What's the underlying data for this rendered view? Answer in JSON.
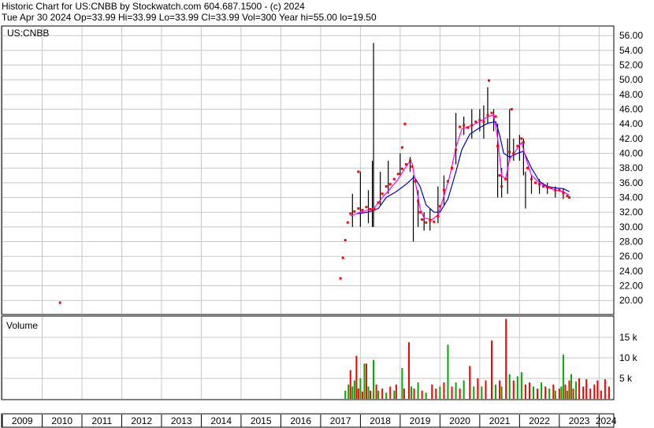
{
  "header": {
    "line1": "Historic Chart for US:CNBB by Stockwatch.com 604.687.1500 - (c) 2024",
    "line2": "Tue Apr 30 2024   Op=33.99   Hi=33.99   Lo=33.99   Cl=33.99   Vol=300   Year hi=55.00   lo=19.50"
  },
  "price_panel": {
    "symbol_label": "US:CNBB"
  },
  "volume_panel": {
    "title": "Volume"
  },
  "colors": {
    "price_bar": "#000000",
    "close_dot": "#ff0000",
    "ma_short": "#ff00ff",
    "ma_long": "#0000cc",
    "vol_up": "#00aa00",
    "vol_down": "#ff0000",
    "grid": "#c8c8c8"
  },
  "chart_data": [
    {
      "type": "line",
      "name": "price",
      "y_ticks": [
        "56.00",
        "54.00",
        "52.00",
        "50.00",
        "48.00",
        "46.00",
        "44.00",
        "42.00",
        "40.00",
        "38.00",
        "36.00",
        "34.00",
        "32.00",
        "30.00",
        "28.00",
        "26.00",
        "24.00",
        "22.00",
        "20.00"
      ],
      "ylim": [
        18.2,
        57.2
      ],
      "x_ticks": [
        "2009",
        "2010",
        "2011",
        "2012",
        "2013",
        "2014",
        "2015",
        "2016",
        "2017",
        "2018",
        "2019",
        "2020",
        "2021",
        "2022",
        "2023",
        "2024"
      ],
      "xlim": [
        2009.0,
        2024.35
      ],
      "grid": true,
      "closes": [
        [
          2010.45,
          19.7
        ],
        [
          2017.5,
          23.0
        ],
        [
          2017.56,
          25.8
        ],
        [
          2017.62,
          28.2
        ],
        [
          2017.68,
          30.6
        ],
        [
          2017.75,
          31.8
        ],
        [
          2017.85,
          32.1
        ],
        [
          2017.95,
          32.5
        ],
        [
          2018.05,
          32.3
        ],
        [
          2018.15,
          32.7
        ],
        [
          2018.25,
          32.4
        ],
        [
          2018.35,
          32.4
        ],
        [
          2018.45,
          33.3
        ],
        [
          2018.55,
          34.5
        ],
        [
          2018.65,
          35.5
        ],
        [
          2018.75,
          35.8
        ],
        [
          2018.85,
          36.5
        ],
        [
          2018.95,
          37.2
        ],
        [
          2019.05,
          37.9
        ],
        [
          2019.15,
          38.5
        ],
        [
          2019.25,
          39.0
        ],
        [
          2019.3,
          38.2
        ],
        [
          2019.38,
          36.2
        ],
        [
          2019.45,
          33.5
        ],
        [
          2019.5,
          32.0
        ],
        [
          2019.55,
          31.0
        ],
        [
          2019.65,
          30.6
        ],
        [
          2019.75,
          30.9
        ],
        [
          2019.85,
          30.7
        ],
        [
          2019.95,
          31.5
        ],
        [
          2020.0,
          32.8
        ],
        [
          2020.1,
          35.0
        ],
        [
          2020.2,
          36.2
        ],
        [
          2020.3,
          38.0
        ],
        [
          2020.4,
          40.5
        ],
        [
          2020.5,
          43.6
        ],
        [
          2020.6,
          43.8
        ],
        [
          2020.7,
          43.5
        ],
        [
          2020.8,
          43.8
        ],
        [
          2020.9,
          44.3
        ],
        [
          2021.0,
          44.5
        ],
        [
          2021.1,
          44.3
        ],
        [
          2021.2,
          45.2
        ],
        [
          2021.3,
          45.5
        ],
        [
          2021.4,
          45.0
        ],
        [
          2021.45,
          41.0
        ],
        [
          2021.5,
          37.0
        ],
        [
          2021.55,
          35.5
        ],
        [
          2021.65,
          36.5
        ],
        [
          2021.75,
          40.2
        ],
        [
          2021.85,
          40.0
        ],
        [
          2021.95,
          41.0
        ],
        [
          2022.05,
          42.0
        ],
        [
          2022.1,
          41.5
        ],
        [
          2022.2,
          38.0
        ],
        [
          2022.3,
          36.5
        ],
        [
          2022.4,
          36.0
        ],
        [
          2022.5,
          35.8
        ],
        [
          2022.6,
          35.5
        ],
        [
          2022.7,
          35.4
        ],
        [
          2022.8,
          35.3
        ],
        [
          2022.9,
          35.0
        ],
        [
          2023.0,
          35.0
        ],
        [
          2023.1,
          34.6
        ],
        [
          2023.2,
          34.2
        ],
        [
          2023.25,
          33.99
        ]
      ],
      "ranges": [
        [
          2017.8,
          30.0,
          34.5
        ],
        [
          2018.0,
          30.0,
          37.5
        ],
        [
          2018.2,
          30.5,
          35.0
        ],
        [
          2018.3,
          30.0,
          39.0
        ],
        [
          2018.33,
          30.0,
          55.0
        ],
        [
          2018.5,
          33.0,
          37.5
        ],
        [
          2018.7,
          34.5,
          39.0
        ],
        [
          2019.0,
          37.0,
          40.0
        ],
        [
          2019.25,
          37.5,
          39.5
        ],
        [
          2019.33,
          28.0,
          37.0
        ],
        [
          2019.45,
          30.0,
          35.0
        ],
        [
          2019.6,
          29.5,
          32.0
        ],
        [
          2019.75,
          29.5,
          32.5
        ],
        [
          2019.95,
          30.5,
          35.5
        ],
        [
          2020.1,
          33.0,
          37.0
        ],
        [
          2020.4,
          38.5,
          45.5
        ],
        [
          2020.6,
          42.5,
          45.0
        ],
        [
          2020.8,
          42.0,
          46.0
        ],
        [
          2021.0,
          43.0,
          46.0
        ],
        [
          2021.1,
          42.0,
          46.5
        ],
        [
          2021.2,
          44.0,
          49.0
        ],
        [
          2021.35,
          43.0,
          46.0
        ],
        [
          2021.45,
          34.0,
          44.0
        ],
        [
          2021.55,
          34.0,
          38.0
        ],
        [
          2021.7,
          34.5,
          42.0
        ],
        [
          2021.75,
          39.0,
          46.0
        ],
        [
          2021.85,
          39.0,
          42.0
        ],
        [
          2022.0,
          39.0,
          42.5
        ],
        [
          2022.1,
          37.0,
          42.0
        ],
        [
          2022.15,
          32.5,
          37.5
        ],
        [
          2022.3,
          34.5,
          37.0
        ],
        [
          2022.5,
          34.5,
          36.5
        ],
        [
          2022.7,
          34.5,
          36.0
        ],
        [
          2022.9,
          34.0,
          35.5
        ],
        [
          2023.1,
          33.8,
          35.2
        ]
      ],
      "scatter_highs": [
        [
          2017.95,
          37.5
        ],
        [
          2019.05,
          40.8
        ],
        [
          2019.12,
          44.0
        ],
        [
          2021.23,
          49.9
        ],
        [
          2021.8,
          46.0
        ]
      ],
      "series": [
        {
          "name": "short moving average",
          "points": [
            [
              2017.75,
              31.5
            ],
            [
              2018.0,
              32.0
            ],
            [
              2018.2,
              32.3
            ],
            [
              2018.35,
              32.6
            ],
            [
              2018.55,
              34.0
            ],
            [
              2018.75,
              35.2
            ],
            [
              2018.95,
              36.5
            ],
            [
              2019.1,
              37.8
            ],
            [
              2019.25,
              39.0
            ],
            [
              2019.3,
              38.6
            ],
            [
              2019.4,
              35.5
            ],
            [
              2019.5,
              32.5
            ],
            [
              2019.6,
              31.2
            ],
            [
              2019.8,
              31.0
            ],
            [
              2019.95,
              31.6
            ],
            [
              2020.1,
              34.2
            ],
            [
              2020.25,
              37.0
            ],
            [
              2020.4,
              40.8
            ],
            [
              2020.55,
              43.3
            ],
            [
              2020.75,
              43.7
            ],
            [
              2021.0,
              44.3
            ],
            [
              2021.2,
              45.0
            ],
            [
              2021.35,
              45.2
            ],
            [
              2021.45,
              42.0
            ],
            [
              2021.55,
              37.0
            ],
            [
              2021.65,
              36.5
            ],
            [
              2021.75,
              39.2
            ],
            [
              2021.9,
              40.3
            ],
            [
              2022.05,
              41.5
            ],
            [
              2022.15,
              39.5
            ],
            [
              2022.3,
              37.0
            ],
            [
              2022.5,
              36.0
            ],
            [
              2022.7,
              35.4
            ],
            [
              2022.9,
              35.0
            ],
            [
              2023.1,
              34.8
            ],
            [
              2023.25,
              34.3
            ]
          ]
        },
        {
          "name": "long moving average",
          "points": [
            [
              2017.9,
              31.8
            ],
            [
              2018.2,
              32.0
            ],
            [
              2018.45,
              32.5
            ],
            [
              2018.65,
              34.0
            ],
            [
              2018.9,
              34.8
            ],
            [
              2019.15,
              35.8
            ],
            [
              2019.35,
              36.8
            ],
            [
              2019.5,
              35.5
            ],
            [
              2019.65,
              33.0
            ],
            [
              2019.85,
              32.0
            ],
            [
              2020.0,
              32.0
            ],
            [
              2020.2,
              33.8
            ],
            [
              2020.4,
              37.5
            ],
            [
              2020.55,
              40.5
            ],
            [
              2020.75,
              42.6
            ],
            [
              2021.0,
              43.5
            ],
            [
              2021.2,
              44.1
            ],
            [
              2021.4,
              44.3
            ],
            [
              2021.5,
              42.5
            ],
            [
              2021.6,
              40.0
            ],
            [
              2021.75,
              39.5
            ],
            [
              2021.95,
              40.0
            ],
            [
              2022.1,
              40.3
            ],
            [
              2022.3,
              38.0
            ],
            [
              2022.5,
              36.2
            ],
            [
              2022.7,
              35.5
            ],
            [
              2022.9,
              35.3
            ],
            [
              2023.1,
              35.2
            ],
            [
              2023.25,
              34.8
            ]
          ]
        }
      ]
    },
    {
      "type": "bar",
      "name": "volume",
      "y_ticks": [
        "15 k",
        "10 k",
        "5 k"
      ],
      "ylim": [
        0,
        20000
      ],
      "bars": [
        [
          2017.62,
          2000,
          "u"
        ],
        [
          2017.7,
          3500,
          "u"
        ],
        [
          2017.75,
          7000,
          "d"
        ],
        [
          2017.8,
          3000,
          "u"
        ],
        [
          2017.85,
          4500,
          "u"
        ],
        [
          2017.9,
          10500,
          "d"
        ],
        [
          2017.95,
          2500,
          "d"
        ],
        [
          2018.0,
          5000,
          "u"
        ],
        [
          2018.05,
          1800,
          "d"
        ],
        [
          2018.1,
          8600,
          "u"
        ],
        [
          2018.15,
          8600,
          "d"
        ],
        [
          2018.2,
          3000,
          "u"
        ],
        [
          2018.25,
          2000,
          "d"
        ],
        [
          2018.33,
          9500,
          "u"
        ],
        [
          2018.4,
          3500,
          "d"
        ],
        [
          2018.45,
          2000,
          "u"
        ],
        [
          2018.55,
          2500,
          "d"
        ],
        [
          2018.65,
          1500,
          "u"
        ],
        [
          2018.75,
          3000,
          "d"
        ],
        [
          2018.85,
          2000,
          "u"
        ],
        [
          2018.9,
          3500,
          "d"
        ],
        [
          2019.05,
          7500,
          "u"
        ],
        [
          2019.1,
          2500,
          "d"
        ],
        [
          2019.22,
          13800,
          "d"
        ],
        [
          2019.28,
          3000,
          "u"
        ],
        [
          2019.35,
          2500,
          "d"
        ],
        [
          2019.45,
          4000,
          "u"
        ],
        [
          2019.55,
          2000,
          "d"
        ],
        [
          2019.65,
          1500,
          "u"
        ],
        [
          2019.8,
          3500,
          "d"
        ],
        [
          2019.9,
          2500,
          "d"
        ],
        [
          2020.0,
          3000,
          "u"
        ],
        [
          2020.1,
          4000,
          "d"
        ],
        [
          2020.2,
          13200,
          "u"
        ],
        [
          2020.3,
          3000,
          "d"
        ],
        [
          2020.4,
          4000,
          "u"
        ],
        [
          2020.5,
          2500,
          "d"
        ],
        [
          2020.6,
          4500,
          "u"
        ],
        [
          2020.75,
          8000,
          "d"
        ],
        [
          2020.85,
          3000,
          "u"
        ],
        [
          2020.95,
          5000,
          "d"
        ],
        [
          2021.05,
          3000,
          "u"
        ],
        [
          2021.15,
          4500,
          "d"
        ],
        [
          2021.3,
          14200,
          "d"
        ],
        [
          2021.4,
          3500,
          "u"
        ],
        [
          2021.5,
          4500,
          "d"
        ],
        [
          2021.55,
          3000,
          "u"
        ],
        [
          2021.66,
          19500,
          "d"
        ],
        [
          2021.75,
          6000,
          "u"
        ],
        [
          2021.85,
          4500,
          "d"
        ],
        [
          2021.95,
          5500,
          "u"
        ],
        [
          2022.05,
          6500,
          "u"
        ],
        [
          2022.15,
          3500,
          "d"
        ],
        [
          2022.25,
          4000,
          "d"
        ],
        [
          2022.35,
          3000,
          "u"
        ],
        [
          2022.45,
          2500,
          "d"
        ],
        [
          2022.55,
          4000,
          "u"
        ],
        [
          2022.65,
          3000,
          "d"
        ],
        [
          2022.75,
          2500,
          "u"
        ],
        [
          2022.85,
          3500,
          "d"
        ],
        [
          2022.9,
          2000,
          "u"
        ],
        [
          2023.0,
          2500,
          "d"
        ],
        [
          2023.05,
          3000,
          "u"
        ],
        [
          2023.1,
          10800,
          "u"
        ],
        [
          2023.15,
          3500,
          "d"
        ],
        [
          2023.2,
          2000,
          "u"
        ],
        [
          2023.25,
          4500,
          "d"
        ],
        [
          2023.3,
          6000,
          "u"
        ],
        [
          2023.35,
          2500,
          "d"
        ],
        [
          2023.42,
          4200,
          "u"
        ],
        [
          2023.5,
          5000,
          "d"
        ],
        [
          2023.6,
          3000,
          "d"
        ],
        [
          2023.68,
          4800,
          "d"
        ],
        [
          2023.78,
          2500,
          "d"
        ],
        [
          2023.88,
          3500,
          "d"
        ],
        [
          2023.96,
          4500,
          "d"
        ],
        [
          2024.05,
          2000,
          "d"
        ],
        [
          2024.15,
          4800,
          "d"
        ],
        [
          2024.25,
          3000,
          "d"
        ]
      ]
    }
  ]
}
